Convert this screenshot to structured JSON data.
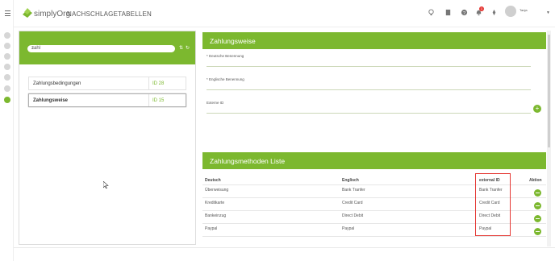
{
  "header": {
    "logo_text": "simplyOrg",
    "title": "NACHSCHLAGETABELLEN",
    "notification_count": "1",
    "user_name": "Tanja",
    "icons": [
      "lightbulb-icon",
      "book-icon",
      "help-icon",
      "bell-icon",
      "rocket-icon"
    ]
  },
  "sidebar": {
    "icons": [
      "menu-icon",
      "nav-icon-1",
      "nav-icon-2",
      "nav-icon-3",
      "nav-icon-4",
      "nav-icon-5",
      "nav-icon-6",
      "nav-icon-active"
    ]
  },
  "search": {
    "value": "zahl"
  },
  "list": [
    {
      "name": "Zahlungsbedingungen",
      "id": "ID 28"
    },
    {
      "name": "Zahlungsweise",
      "id": "ID 15"
    }
  ],
  "detail": {
    "title": "Zahlungsweise",
    "fields": {
      "german_label": "* Deutsche Benennung",
      "english_label": "* Englische Benennung",
      "external_label": "Externe ID"
    }
  },
  "methods": {
    "title": "Zahlungsmethoden Liste",
    "columns": [
      "Deutsch",
      "Englisch",
      "external ID",
      "Aktion"
    ],
    "rows": [
      {
        "de": "Überweisung",
        "en": "Bank Tranfer",
        "ext": "Bank Tranfer"
      },
      {
        "de": "Kreditkarte",
        "en": "Credit Card",
        "ext": "Credit Card"
      },
      {
        "de": "Bankeinzug",
        "en": "Direct Debit",
        "ext": "Direct Debit"
      },
      {
        "de": "Paypal",
        "en": "Paypal",
        "ext": "Paypal"
      }
    ]
  },
  "colors": {
    "accent": "#7cb82f",
    "highlight": "#e53935"
  }
}
